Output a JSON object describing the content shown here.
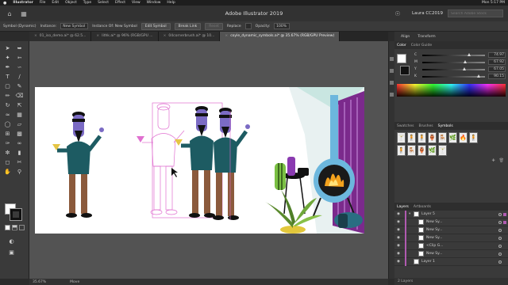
{
  "mac_menu": {
    "apple": "",
    "app": "Illustrator",
    "items": [
      "File",
      "Edit",
      "Object",
      "Type",
      "Select",
      "Effect",
      "View",
      "Window",
      "Help"
    ],
    "clock": "Mon 5:17 PM"
  },
  "app_bar": {
    "title": "Adobe Illustrator 2019",
    "account": "Laura CC2019",
    "search_placeholder": "Search Adobe Stock"
  },
  "control_bar": {
    "selection_type": "Symbol (Dynamic)",
    "instance_label": "Instance:",
    "instance_value": "New Symbol",
    "instance_of_label": "Instance Of: New Symbol",
    "edit_symbol": "Edit Symbol",
    "break_link": "Break Link",
    "reset": "Reset",
    "replace": "Replace",
    "opacity_label": "Opacity:",
    "opacity_value": "100%"
  },
  "doc_tabs": [
    {
      "label": "01_iso_demo.ai* @ 62.5...",
      "active": false
    },
    {
      "label": "lithk.ai* @ 96% (RGB/GPU ...",
      "active": false
    },
    {
      "label": "04cornerbrush.ai* @ 10...",
      "active": false
    },
    {
      "label": "coyle_dynamic_symbols.ai* @ 35.67% (RGB/GPU Preview)",
      "active": true
    }
  ],
  "status_bar": {
    "zoom": "35.67%",
    "tool": "Move"
  },
  "right_panels": {
    "top_tabs": [
      "Align",
      "Transform"
    ],
    "color_tabs": [
      "Color",
      "Color Guide"
    ],
    "color_values": [
      {
        "label": "C",
        "value": "74.97",
        "fraction": 0.75
      },
      {
        "label": "M",
        "value": "67.92",
        "fraction": 0.68
      },
      {
        "label": "Y",
        "value": "67.05",
        "fraction": 0.67
      },
      {
        "label": "K",
        "value": "90.15",
        "fraction": 0.9
      }
    ],
    "lib_tabs": [
      "Swatches",
      "Brushes",
      "Symbols"
    ],
    "symbols": [
      "🍸",
      "🧍",
      "🧍",
      "🏺",
      "🪑",
      "🌿",
      "🔥",
      "🧍",
      "🧍",
      "🪑",
      "🏺",
      "🌿",
      "🍸"
    ],
    "layers_tabs": [
      "Layers",
      "Artboards"
    ],
    "layers": [
      {
        "name": "Layer 5",
        "depth": 0,
        "expanded": true,
        "selected": true
      },
      {
        "name": "New Sy...",
        "depth": 1,
        "expanded": false,
        "selected": true
      },
      {
        "name": "New Sy...",
        "depth": 1,
        "expanded": false,
        "selected": false
      },
      {
        "name": "New Sy...",
        "depth": 1,
        "expanded": false,
        "selected": false
      },
      {
        "name": "<Clip G...",
        "depth": 1,
        "expanded": false,
        "selected": false
      },
      {
        "name": "New Sy...",
        "depth": 1,
        "expanded": false,
        "selected": false
      },
      {
        "name": "Layer 1",
        "depth": 0,
        "expanded": false,
        "selected": false
      }
    ],
    "layers_count": "2 Layers"
  },
  "colors": {
    "figure_body": "#1d5b62",
    "figure_pants": "#8b5a3c",
    "figure_face": "#7b6bc4",
    "wall_purple": "#7b2a8c",
    "fireplace_blue": "#6cb7dd",
    "selection_pink": "#e070d0"
  }
}
